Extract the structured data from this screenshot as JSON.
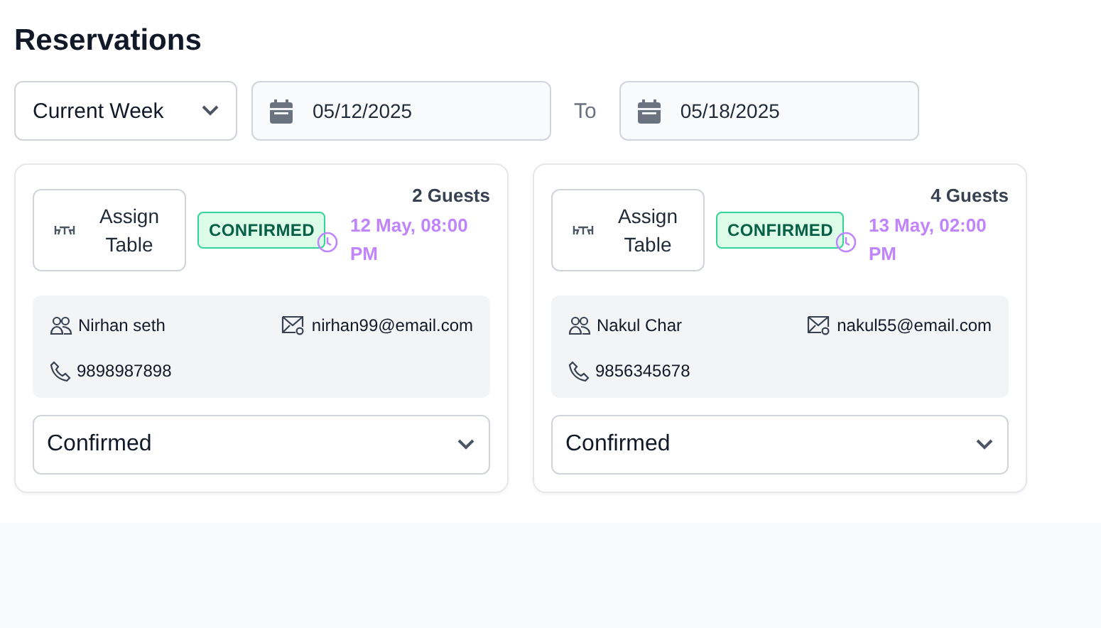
{
  "title": "Reservations",
  "filters": {
    "period": "Current Week",
    "from": "05/12/2025",
    "to_label": "To",
    "to": "05/18/2025"
  },
  "reservations": [
    {
      "assign_label": "Assign Table",
      "badge": "CONFIRMED",
      "guests": "2 Guests",
      "time": "12 May, 08:00 PM",
      "name": "Nirhan seth",
      "email": "nirhan99@email.com",
      "phone": "9898987898",
      "status": "Confirmed"
    },
    {
      "assign_label": "Assign Table",
      "badge": "CONFIRMED",
      "guests": "4 Guests",
      "time": "13 May, 02:00 PM",
      "name": "Nakul Char",
      "email": "nakul55@email.com",
      "phone": "9856345678",
      "status": "Confirmed"
    }
  ]
}
